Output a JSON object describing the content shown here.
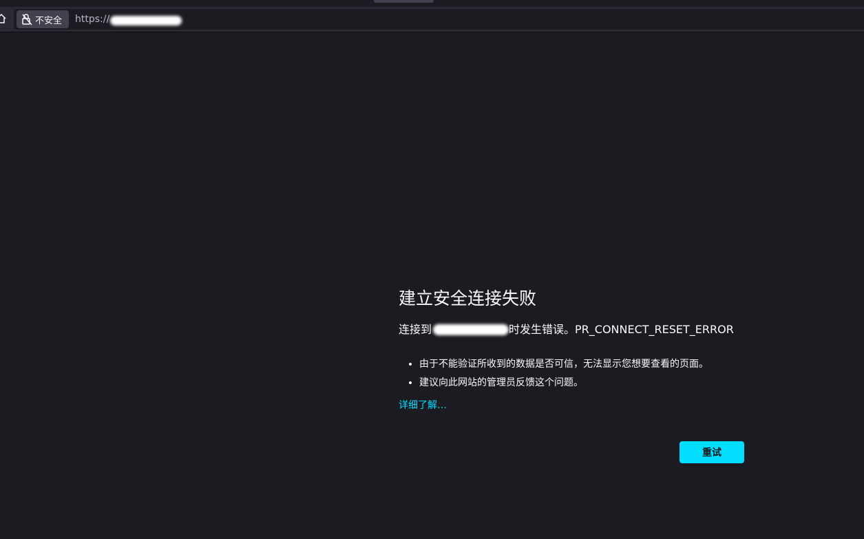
{
  "browser": {
    "security_label": "不安全",
    "url_prefix": "https://"
  },
  "error_page": {
    "title": "建立安全连接失败",
    "desc_prefix": "连接到",
    "desc_suffix": "时发生错误。PR_CONNECT_RESET_ERROR",
    "reasons": [
      "由于不能验证所收到的数据是否可信，无法显示您想要查看的页面。",
      "建议向此网站的管理员反馈这个问题。"
    ],
    "learn_more": "详细了解…",
    "retry_label": "重试"
  },
  "colors": {
    "background": "#1c1b22",
    "toolbar": "#2b2a33",
    "accent": "#00ddff"
  }
}
